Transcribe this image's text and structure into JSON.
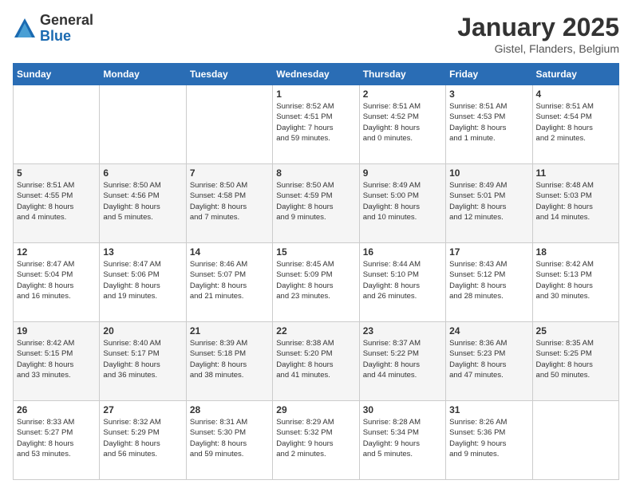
{
  "logo": {
    "general": "General",
    "blue": "Blue"
  },
  "header": {
    "title": "January 2025",
    "subtitle": "Gistel, Flanders, Belgium"
  },
  "weekdays": [
    "Sunday",
    "Monday",
    "Tuesday",
    "Wednesday",
    "Thursday",
    "Friday",
    "Saturday"
  ],
  "weeks": [
    [
      {
        "day": "",
        "info": ""
      },
      {
        "day": "",
        "info": ""
      },
      {
        "day": "",
        "info": ""
      },
      {
        "day": "1",
        "info": "Sunrise: 8:52 AM\nSunset: 4:51 PM\nDaylight: 7 hours\nand 59 minutes."
      },
      {
        "day": "2",
        "info": "Sunrise: 8:51 AM\nSunset: 4:52 PM\nDaylight: 8 hours\nand 0 minutes."
      },
      {
        "day": "3",
        "info": "Sunrise: 8:51 AM\nSunset: 4:53 PM\nDaylight: 8 hours\nand 1 minute."
      },
      {
        "day": "4",
        "info": "Sunrise: 8:51 AM\nSunset: 4:54 PM\nDaylight: 8 hours\nand 2 minutes."
      }
    ],
    [
      {
        "day": "5",
        "info": "Sunrise: 8:51 AM\nSunset: 4:55 PM\nDaylight: 8 hours\nand 4 minutes."
      },
      {
        "day": "6",
        "info": "Sunrise: 8:50 AM\nSunset: 4:56 PM\nDaylight: 8 hours\nand 5 minutes."
      },
      {
        "day": "7",
        "info": "Sunrise: 8:50 AM\nSunset: 4:58 PM\nDaylight: 8 hours\nand 7 minutes."
      },
      {
        "day": "8",
        "info": "Sunrise: 8:50 AM\nSunset: 4:59 PM\nDaylight: 8 hours\nand 9 minutes."
      },
      {
        "day": "9",
        "info": "Sunrise: 8:49 AM\nSunset: 5:00 PM\nDaylight: 8 hours\nand 10 minutes."
      },
      {
        "day": "10",
        "info": "Sunrise: 8:49 AM\nSunset: 5:01 PM\nDaylight: 8 hours\nand 12 minutes."
      },
      {
        "day": "11",
        "info": "Sunrise: 8:48 AM\nSunset: 5:03 PM\nDaylight: 8 hours\nand 14 minutes."
      }
    ],
    [
      {
        "day": "12",
        "info": "Sunrise: 8:47 AM\nSunset: 5:04 PM\nDaylight: 8 hours\nand 16 minutes."
      },
      {
        "day": "13",
        "info": "Sunrise: 8:47 AM\nSunset: 5:06 PM\nDaylight: 8 hours\nand 19 minutes."
      },
      {
        "day": "14",
        "info": "Sunrise: 8:46 AM\nSunset: 5:07 PM\nDaylight: 8 hours\nand 21 minutes."
      },
      {
        "day": "15",
        "info": "Sunrise: 8:45 AM\nSunset: 5:09 PM\nDaylight: 8 hours\nand 23 minutes."
      },
      {
        "day": "16",
        "info": "Sunrise: 8:44 AM\nSunset: 5:10 PM\nDaylight: 8 hours\nand 26 minutes."
      },
      {
        "day": "17",
        "info": "Sunrise: 8:43 AM\nSunset: 5:12 PM\nDaylight: 8 hours\nand 28 minutes."
      },
      {
        "day": "18",
        "info": "Sunrise: 8:42 AM\nSunset: 5:13 PM\nDaylight: 8 hours\nand 30 minutes."
      }
    ],
    [
      {
        "day": "19",
        "info": "Sunrise: 8:42 AM\nSunset: 5:15 PM\nDaylight: 8 hours\nand 33 minutes."
      },
      {
        "day": "20",
        "info": "Sunrise: 8:40 AM\nSunset: 5:17 PM\nDaylight: 8 hours\nand 36 minutes."
      },
      {
        "day": "21",
        "info": "Sunrise: 8:39 AM\nSunset: 5:18 PM\nDaylight: 8 hours\nand 38 minutes."
      },
      {
        "day": "22",
        "info": "Sunrise: 8:38 AM\nSunset: 5:20 PM\nDaylight: 8 hours\nand 41 minutes."
      },
      {
        "day": "23",
        "info": "Sunrise: 8:37 AM\nSunset: 5:22 PM\nDaylight: 8 hours\nand 44 minutes."
      },
      {
        "day": "24",
        "info": "Sunrise: 8:36 AM\nSunset: 5:23 PM\nDaylight: 8 hours\nand 47 minutes."
      },
      {
        "day": "25",
        "info": "Sunrise: 8:35 AM\nSunset: 5:25 PM\nDaylight: 8 hours\nand 50 minutes."
      }
    ],
    [
      {
        "day": "26",
        "info": "Sunrise: 8:33 AM\nSunset: 5:27 PM\nDaylight: 8 hours\nand 53 minutes."
      },
      {
        "day": "27",
        "info": "Sunrise: 8:32 AM\nSunset: 5:29 PM\nDaylight: 8 hours\nand 56 minutes."
      },
      {
        "day": "28",
        "info": "Sunrise: 8:31 AM\nSunset: 5:30 PM\nDaylight: 8 hours\nand 59 minutes."
      },
      {
        "day": "29",
        "info": "Sunrise: 8:29 AM\nSunset: 5:32 PM\nDaylight: 9 hours\nand 2 minutes."
      },
      {
        "day": "30",
        "info": "Sunrise: 8:28 AM\nSunset: 5:34 PM\nDaylight: 9 hours\nand 5 minutes."
      },
      {
        "day": "31",
        "info": "Sunrise: 8:26 AM\nSunset: 5:36 PM\nDaylight: 9 hours\nand 9 minutes."
      },
      {
        "day": "",
        "info": ""
      }
    ]
  ]
}
